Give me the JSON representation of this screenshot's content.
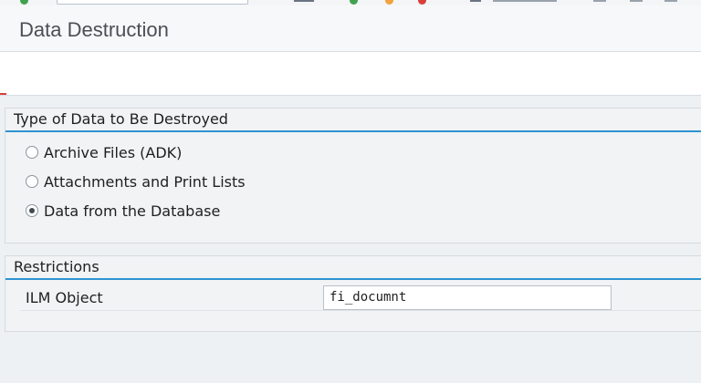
{
  "page": {
    "title": "Data Destruction"
  },
  "type_group": {
    "title": "Type of Data to Be Destroyed",
    "options": [
      {
        "label": "Archive Files (ADK)",
        "selected": false
      },
      {
        "label": "Attachments and Print Lists",
        "selected": false
      },
      {
        "label": "Data from the Database",
        "selected": true
      }
    ]
  },
  "restrictions_group": {
    "title": "Restrictions",
    "ilm_object_label": "ILM Object",
    "ilm_object_value": "fi_documnt"
  },
  "colors": {
    "accent_blue": "#2e93d1",
    "status_green": "#3fa34d",
    "status_orange": "#f2a33a",
    "status_red": "#d8413b"
  },
  "icons": [
    "status-green-icon",
    "status-orange-icon",
    "status-red-icon"
  ]
}
